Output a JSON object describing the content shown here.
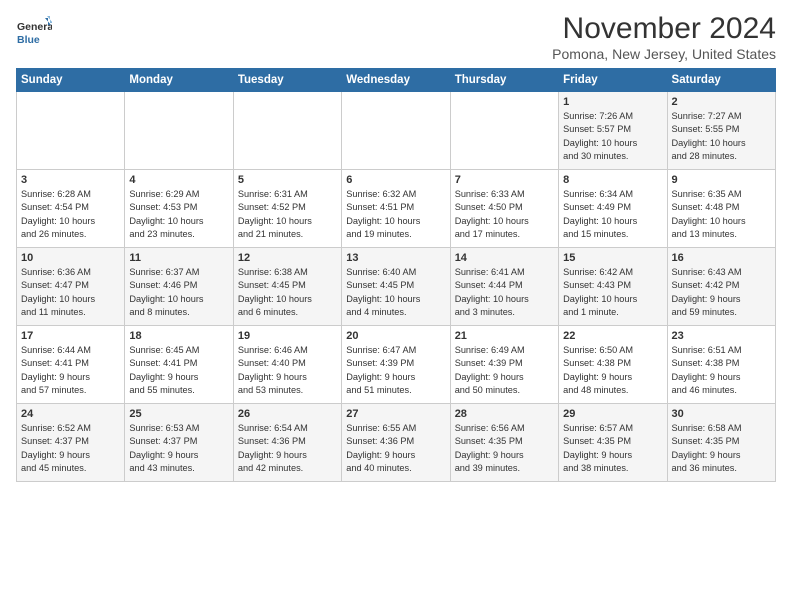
{
  "logo": {
    "line1": "General",
    "line2": "Blue"
  },
  "title": "November 2024",
  "location": "Pomona, New Jersey, United States",
  "days_of_week": [
    "Sunday",
    "Monday",
    "Tuesday",
    "Wednesday",
    "Thursday",
    "Friday",
    "Saturday"
  ],
  "weeks": [
    [
      {
        "day": "",
        "content": ""
      },
      {
        "day": "",
        "content": ""
      },
      {
        "day": "",
        "content": ""
      },
      {
        "day": "",
        "content": ""
      },
      {
        "day": "",
        "content": ""
      },
      {
        "day": "1",
        "content": "Sunrise: 7:26 AM\nSunset: 5:57 PM\nDaylight: 10 hours\nand 30 minutes."
      },
      {
        "day": "2",
        "content": "Sunrise: 7:27 AM\nSunset: 5:55 PM\nDaylight: 10 hours\nand 28 minutes."
      }
    ],
    [
      {
        "day": "3",
        "content": "Sunrise: 6:28 AM\nSunset: 4:54 PM\nDaylight: 10 hours\nand 26 minutes."
      },
      {
        "day": "4",
        "content": "Sunrise: 6:29 AM\nSunset: 4:53 PM\nDaylight: 10 hours\nand 23 minutes."
      },
      {
        "day": "5",
        "content": "Sunrise: 6:31 AM\nSunset: 4:52 PM\nDaylight: 10 hours\nand 21 minutes."
      },
      {
        "day": "6",
        "content": "Sunrise: 6:32 AM\nSunset: 4:51 PM\nDaylight: 10 hours\nand 19 minutes."
      },
      {
        "day": "7",
        "content": "Sunrise: 6:33 AM\nSunset: 4:50 PM\nDaylight: 10 hours\nand 17 minutes."
      },
      {
        "day": "8",
        "content": "Sunrise: 6:34 AM\nSunset: 4:49 PM\nDaylight: 10 hours\nand 15 minutes."
      },
      {
        "day": "9",
        "content": "Sunrise: 6:35 AM\nSunset: 4:48 PM\nDaylight: 10 hours\nand 13 minutes."
      }
    ],
    [
      {
        "day": "10",
        "content": "Sunrise: 6:36 AM\nSunset: 4:47 PM\nDaylight: 10 hours\nand 11 minutes."
      },
      {
        "day": "11",
        "content": "Sunrise: 6:37 AM\nSunset: 4:46 PM\nDaylight: 10 hours\nand 8 minutes."
      },
      {
        "day": "12",
        "content": "Sunrise: 6:38 AM\nSunset: 4:45 PM\nDaylight: 10 hours\nand 6 minutes."
      },
      {
        "day": "13",
        "content": "Sunrise: 6:40 AM\nSunset: 4:45 PM\nDaylight: 10 hours\nand 4 minutes."
      },
      {
        "day": "14",
        "content": "Sunrise: 6:41 AM\nSunset: 4:44 PM\nDaylight: 10 hours\nand 3 minutes."
      },
      {
        "day": "15",
        "content": "Sunrise: 6:42 AM\nSunset: 4:43 PM\nDaylight: 10 hours\nand 1 minute."
      },
      {
        "day": "16",
        "content": "Sunrise: 6:43 AM\nSunset: 4:42 PM\nDaylight: 9 hours\nand 59 minutes."
      }
    ],
    [
      {
        "day": "17",
        "content": "Sunrise: 6:44 AM\nSunset: 4:41 PM\nDaylight: 9 hours\nand 57 minutes."
      },
      {
        "day": "18",
        "content": "Sunrise: 6:45 AM\nSunset: 4:41 PM\nDaylight: 9 hours\nand 55 minutes."
      },
      {
        "day": "19",
        "content": "Sunrise: 6:46 AM\nSunset: 4:40 PM\nDaylight: 9 hours\nand 53 minutes."
      },
      {
        "day": "20",
        "content": "Sunrise: 6:47 AM\nSunset: 4:39 PM\nDaylight: 9 hours\nand 51 minutes."
      },
      {
        "day": "21",
        "content": "Sunrise: 6:49 AM\nSunset: 4:39 PM\nDaylight: 9 hours\nand 50 minutes."
      },
      {
        "day": "22",
        "content": "Sunrise: 6:50 AM\nSunset: 4:38 PM\nDaylight: 9 hours\nand 48 minutes."
      },
      {
        "day": "23",
        "content": "Sunrise: 6:51 AM\nSunset: 4:38 PM\nDaylight: 9 hours\nand 46 minutes."
      }
    ],
    [
      {
        "day": "24",
        "content": "Sunrise: 6:52 AM\nSunset: 4:37 PM\nDaylight: 9 hours\nand 45 minutes."
      },
      {
        "day": "25",
        "content": "Sunrise: 6:53 AM\nSunset: 4:37 PM\nDaylight: 9 hours\nand 43 minutes."
      },
      {
        "day": "26",
        "content": "Sunrise: 6:54 AM\nSunset: 4:36 PM\nDaylight: 9 hours\nand 42 minutes."
      },
      {
        "day": "27",
        "content": "Sunrise: 6:55 AM\nSunset: 4:36 PM\nDaylight: 9 hours\nand 40 minutes."
      },
      {
        "day": "28",
        "content": "Sunrise: 6:56 AM\nSunset: 4:35 PM\nDaylight: 9 hours\nand 39 minutes."
      },
      {
        "day": "29",
        "content": "Sunrise: 6:57 AM\nSunset: 4:35 PM\nDaylight: 9 hours\nand 38 minutes."
      },
      {
        "day": "30",
        "content": "Sunrise: 6:58 AM\nSunset: 4:35 PM\nDaylight: 9 hours\nand 36 minutes."
      }
    ]
  ]
}
